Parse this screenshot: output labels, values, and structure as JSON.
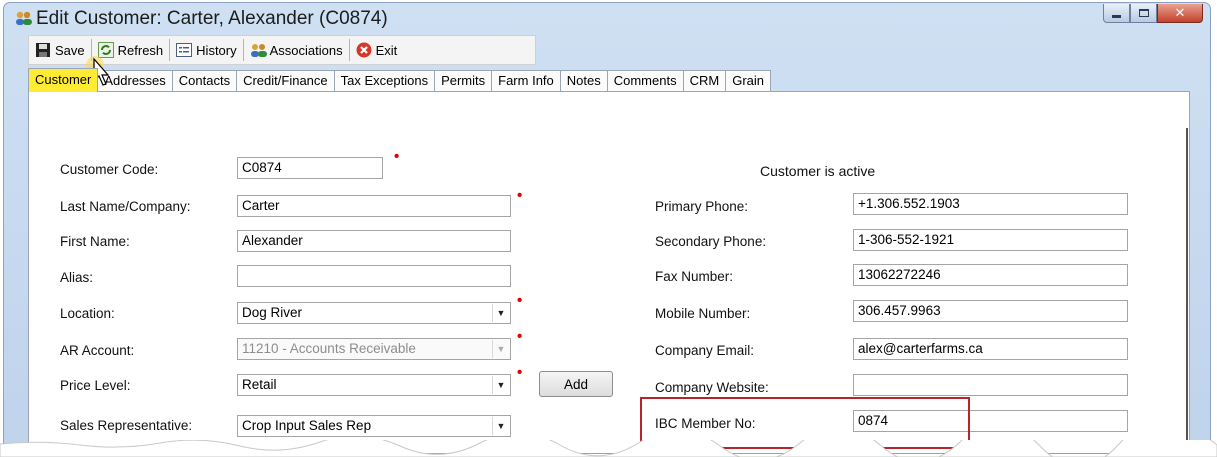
{
  "window": {
    "title": "Edit Customer: Carter, Alexander (C0874)"
  },
  "toolbar": {
    "save": "Save",
    "refresh": "Refresh",
    "history": "History",
    "associations": "Associations",
    "exit": "Exit"
  },
  "tabs": [
    "Customer",
    "Addresses",
    "Contacts",
    "Credit/Finance",
    "Tax Exceptions",
    "Permits",
    "Farm Info",
    "Notes",
    "Comments",
    "CRM",
    "Grain"
  ],
  "active_tab": "Customer",
  "form_left": {
    "customer_code_label": "Customer Code:",
    "customer_code": "C0874",
    "last_name_label": "Last Name/Company:",
    "last_name": "Carter",
    "first_name_label": "First Name:",
    "first_name": "Alexander",
    "alias_label": "Alias:",
    "alias": "",
    "location_label": "Location:",
    "location": "Dog River",
    "ar_account_label": "AR Account:",
    "ar_account": "11210 - Accounts Receivable",
    "price_level_label": "Price Level:",
    "price_level": "Retail",
    "add_button": "Add",
    "sales_rep_label": "Sales Representative:",
    "sales_rep": "Crop Input Sales Rep"
  },
  "form_right": {
    "status": "Customer is active",
    "primary_phone_label": "Primary Phone:",
    "primary_phone": "+1.306.552.1903",
    "secondary_phone_label": "Secondary Phone:",
    "secondary_phone": "1-306-552-1921",
    "fax_label": "Fax Number:",
    "fax": "13062272246",
    "mobile_label": "Mobile Number:",
    "mobile": "306.457.9963",
    "email_label": "Company Email:",
    "email": "alex@carterfarms.ca",
    "website_label": "Company Website:",
    "website": "",
    "ibc_label": "IBC Member No:",
    "ibc": "0874"
  },
  "colors": {
    "active_tab_highlight": "#ffeb33",
    "required_marker": "#e10000",
    "callout_border": "#b5252a"
  }
}
